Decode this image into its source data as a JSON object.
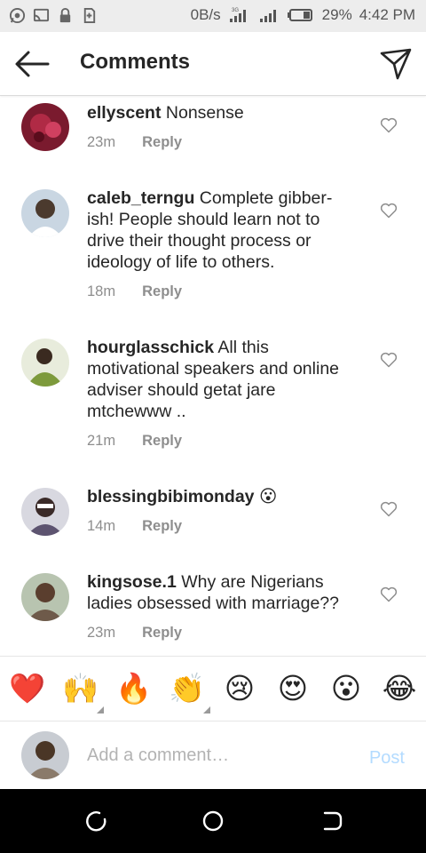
{
  "status_bar": {
    "network_speed": "0B/s",
    "battery": "29%",
    "time": "4:42 PM",
    "icons": [
      "whatsapp-icon",
      "cast-icon",
      "lock-icon",
      "sd-icon",
      "signal-3g-icon",
      "signal-icon",
      "battery-icon"
    ]
  },
  "header": {
    "title": "Comments",
    "back_icon": "arrow-left-icon",
    "send_icon": "send-direct-icon"
  },
  "comments": [
    {
      "username": "ellyscent",
      "text": "Nonsense",
      "time": "23m",
      "reply": "Reply",
      "avatar_color": "#7a1a2e"
    },
    {
      "username": "caleb_terngu",
      "text": "Complete gibber-ish! People should learn not to drive their thought process or ideology of life to others.",
      "time": "18m",
      "reply": "Reply",
      "avatar_color": "#4b6b8a"
    },
    {
      "username": "hourglasschick",
      "text": "All this motivational speakers and online adviser should getat jare mtchewww ..",
      "time": "21m",
      "reply": "Reply",
      "avatar_color": "#7d9a3c"
    },
    {
      "username": "blessingbibimonday",
      "text": "😮",
      "time": "14m",
      "reply": "Reply",
      "avatar_color": "#5d5470"
    },
    {
      "username": "kingsose.1",
      "text": "Why are Nigerians ladies obsessed with marriage??",
      "time": "23m",
      "reply": "Reply",
      "avatar_color": "#6e5a4a"
    }
  ],
  "emoji_bar": [
    "❤️",
    "🙌",
    "🔥",
    "👏",
    "😢",
    "😍",
    "😮",
    "😂"
  ],
  "composer": {
    "placeholder": "Add a comment…",
    "post_label": "Post",
    "avatar_color": "#8a7a6a"
  },
  "colors": {
    "reply_gray": "#8e8e8e",
    "post_disabled": "#b3dbff",
    "status_bar_bg": "#ededed"
  }
}
